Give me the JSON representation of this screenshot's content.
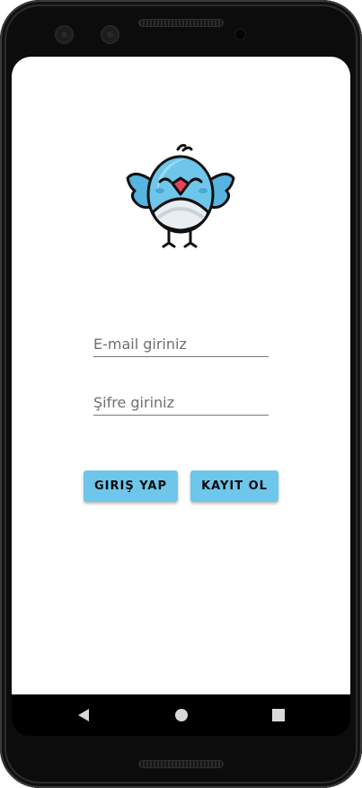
{
  "app": {
    "logo_icon": "blue-bird-icon",
    "accent_color": "#6ec6ea"
  },
  "form": {
    "email_placeholder": "E-mail giriniz",
    "password_placeholder": "Şifre giriniz"
  },
  "buttons": {
    "login_label": "GIRIŞ YAP",
    "register_label": "KAYIT OL"
  },
  "navigation": {
    "back_icon": "back-triangle-icon",
    "home_icon": "home-circle-icon",
    "recents_icon": "recents-square-icon"
  }
}
